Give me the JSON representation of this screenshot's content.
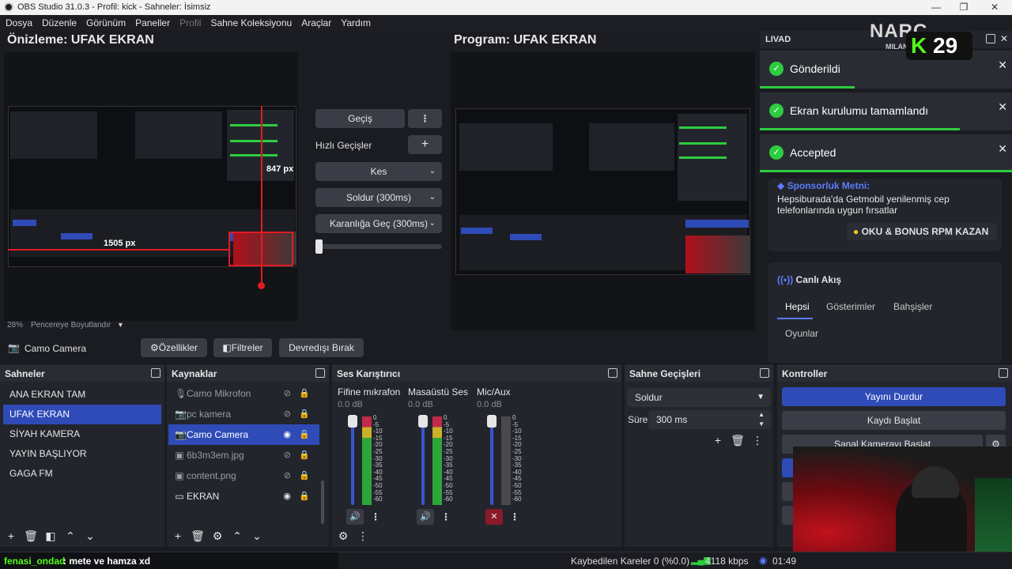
{
  "window": {
    "title": "OBS Studio 31.0.3 - Profil: kick - Sahneler: İsimsiz"
  },
  "menu": [
    "Dosya",
    "Düzenle",
    "Görünüm",
    "Paneller",
    "Profil",
    "Sahne Koleksiyonu",
    "Araçlar",
    "Yardım"
  ],
  "preview": {
    "title": "Önizleme: UFAK EKRAN",
    "zoom": "28%",
    "zoom_mode": "Pencereye Boyutlandır",
    "width_label": "847 px",
    "height_label": "1505 px"
  },
  "program": {
    "title": "Program: UFAK EKRAN"
  },
  "transitions": {
    "gecis": "Geçiş",
    "quick_label": "Hızlı Geçişler",
    "options": [
      "Kes",
      "Soldur (300ms)",
      "Karanlığa Geç (300ms)"
    ]
  },
  "source_bar": {
    "source_name": "Camo Camera",
    "properties": "Özellikler",
    "filters": "Filtreler",
    "deactivate": "Devredışı Bırak"
  },
  "scenes": {
    "title": "Sahneler",
    "items": [
      "ANA EKRAN TAM",
      "UFAK EKRAN",
      "SİYAH KAMERA",
      "YAYIN BAŞLIYOR",
      "GAGA FM"
    ],
    "selected": 1
  },
  "sources": {
    "title": "Kaynaklar",
    "items": [
      {
        "name": "Camo Mikrofon",
        "icon": "mic-icon",
        "visible": false
      },
      {
        "name": "pc kamera",
        "icon": "camera-icon",
        "visible": false
      },
      {
        "name": "Camo Camera",
        "icon": "camera-icon",
        "visible": true
      },
      {
        "name": "6b3m3em.jpg",
        "icon": "image-icon",
        "visible": false
      },
      {
        "name": "content.png",
        "icon": "image-icon",
        "visible": false
      },
      {
        "name": "EKRAN",
        "icon": "monitor-icon",
        "visible": true
      }
    ],
    "selected": 2
  },
  "mixer": {
    "title": "Ses Karıştırıcı",
    "channels": [
      {
        "name": "Fifine mıkrafon",
        "db": "0.0 dB"
      },
      {
        "name": "Masaüstü Ses",
        "db": "0.0 dB"
      },
      {
        "name": "Mic/Aux",
        "db": "0.0 dB"
      }
    ],
    "scale": [
      "0",
      "-5",
      "-10",
      "-15",
      "-20",
      "-25",
      "-30",
      "-35",
      "-40",
      "-45",
      "-50",
      "-55",
      "-60"
    ]
  },
  "scene_transitions": {
    "title": "Sahne Geçişleri",
    "selected": "Soldur",
    "duration_label": "Süre",
    "duration": "300 ms"
  },
  "controls": {
    "title": "Kontroller",
    "stop_stream": "Yayını Durdur",
    "start_record": "Kaydı Başlat",
    "virtual_cam": "Sanal Kamerayı Başlat"
  },
  "chat_dock": {
    "title": "LIVAD",
    "notifications": [
      "Gönderildi",
      "Ekran kurulumu tamamlandı",
      "Accepted"
    ],
    "sponsor_title": "Sponsorluk Metni:",
    "sponsor_text": "Hepsiburada'da Getmobil yenilenmiş cep telefonlarında uygun fırsatlar",
    "sponsor_button": "OKU & BONUS RPM KAZAN",
    "live_title": "Canlı Akış",
    "tabs": [
      "Hepsi",
      "Gösterimler",
      "Bahşişler",
      "Oyunlar"
    ]
  },
  "logo": {
    "text": "NARC",
    "sub": "MILAN",
    "badge": "29"
  },
  "status": {
    "chat_user": "fenasi_ondad",
    "chat_msg": ": mete ve hamza xd",
    "dropped": "Kaybedilen Kareler 0 (%0.0)",
    "bitrate": "4118 kbps",
    "time": "01:49"
  },
  "colors": {
    "accent": "#2f4bb8",
    "success": "#2ecc40"
  }
}
